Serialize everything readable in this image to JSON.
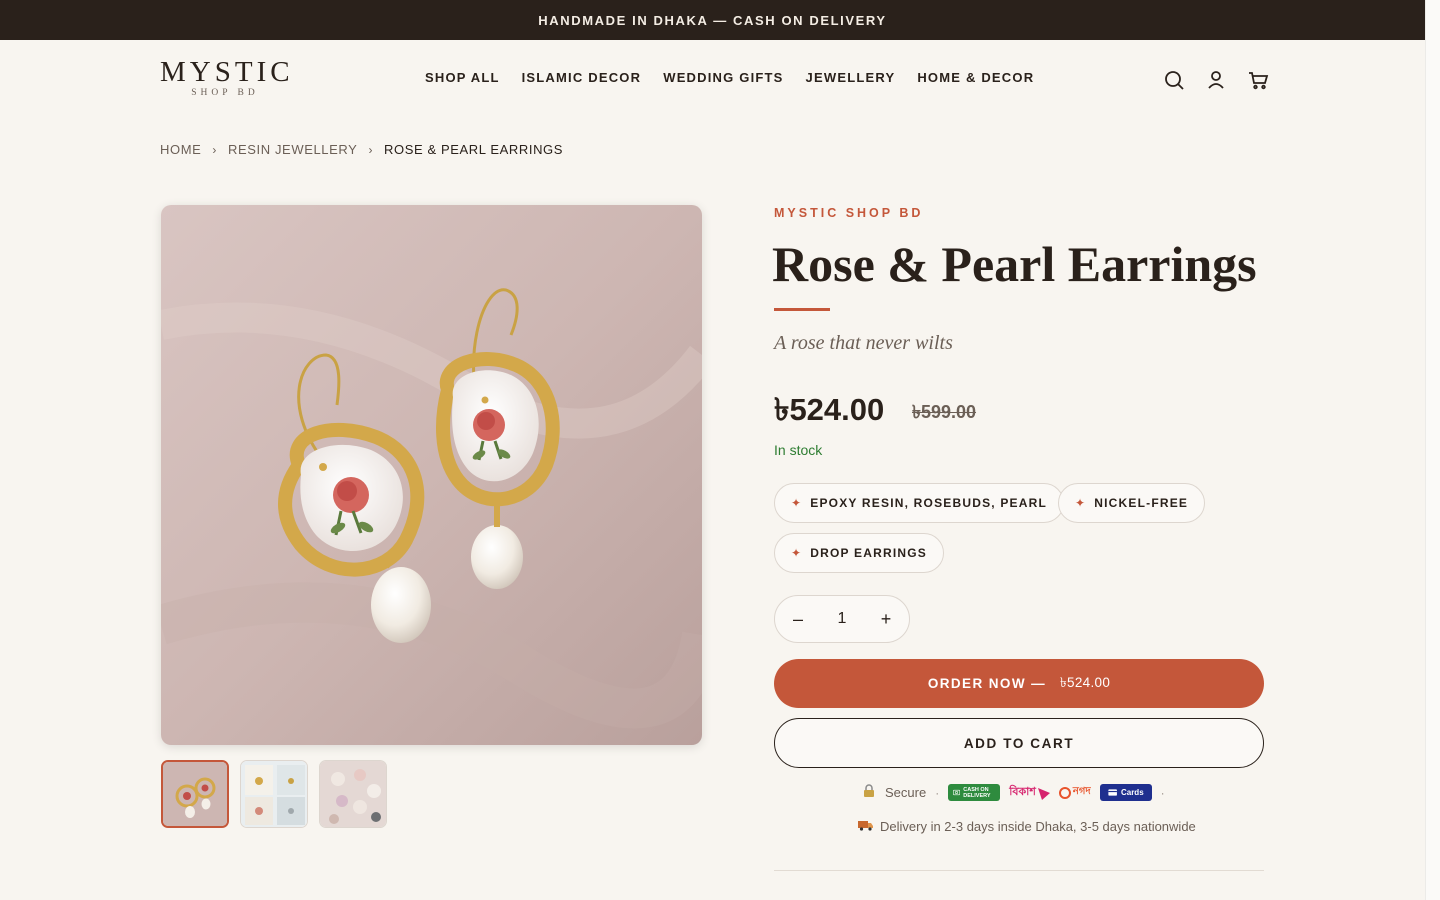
{
  "announcement": "HANDMADE IN DHAKA — CASH ON DELIVERY",
  "logo": {
    "main": "MYSTIC",
    "sub": "SHOP BD"
  },
  "nav": [
    {
      "label": "SHOP ALL"
    },
    {
      "label": "ISLAMIC DECOR"
    },
    {
      "label": "WEDDING GIFTS"
    },
    {
      "label": "JEWELLERY"
    },
    {
      "label": "HOME & DECOR"
    }
  ],
  "header_icons": [
    "search-icon",
    "account-icon",
    "cart-icon"
  ],
  "breadcrumb": {
    "home": "HOME",
    "category": "RESIN JEWELLERY",
    "current": "ROSE & PEARL EARRINGS",
    "separator": "›"
  },
  "product": {
    "brand": "MYSTIC SHOP BD",
    "title": "Rose & Pearl Earrings",
    "tagline": "A rose that never wilts",
    "price": "৳524.00",
    "compare_price": "৳599.00",
    "stock": "In stock",
    "features": [
      {
        "label": "EPOXY RESIN, ROSEBUDS, PEARL"
      },
      {
        "label": "NICKEL-FREE"
      },
      {
        "label": "DROP EARRINGS"
      }
    ],
    "quantity": "1",
    "qty_minus": "–",
    "qty_plus": "+",
    "order_label": "ORDER NOW —",
    "order_amount": "৳524.00",
    "cart_label": "ADD TO CART"
  },
  "payments": {
    "secure": "Secure",
    "dot": "·",
    "badges": [
      {
        "name": "cash-on-delivery-badge",
        "text": "CASH ON DELIVERY",
        "color": "#2e8b3e"
      },
      {
        "name": "bkash-badge",
        "text": "বিকাশ",
        "color": "#d6246e"
      },
      {
        "name": "nagad-badge",
        "text": "নগদ",
        "color": "#e8532b"
      },
      {
        "name": "cards-badge",
        "text": "Cards",
        "color": "#1f2f8f"
      }
    ]
  },
  "delivery": "Delivery in 2-3 days inside Dhaka, 3-5 days nationwide",
  "colors": {
    "accent": "#c4573a",
    "dark": "#2a211b",
    "background": "#f8f5f0",
    "stock": "#2e7d32"
  }
}
